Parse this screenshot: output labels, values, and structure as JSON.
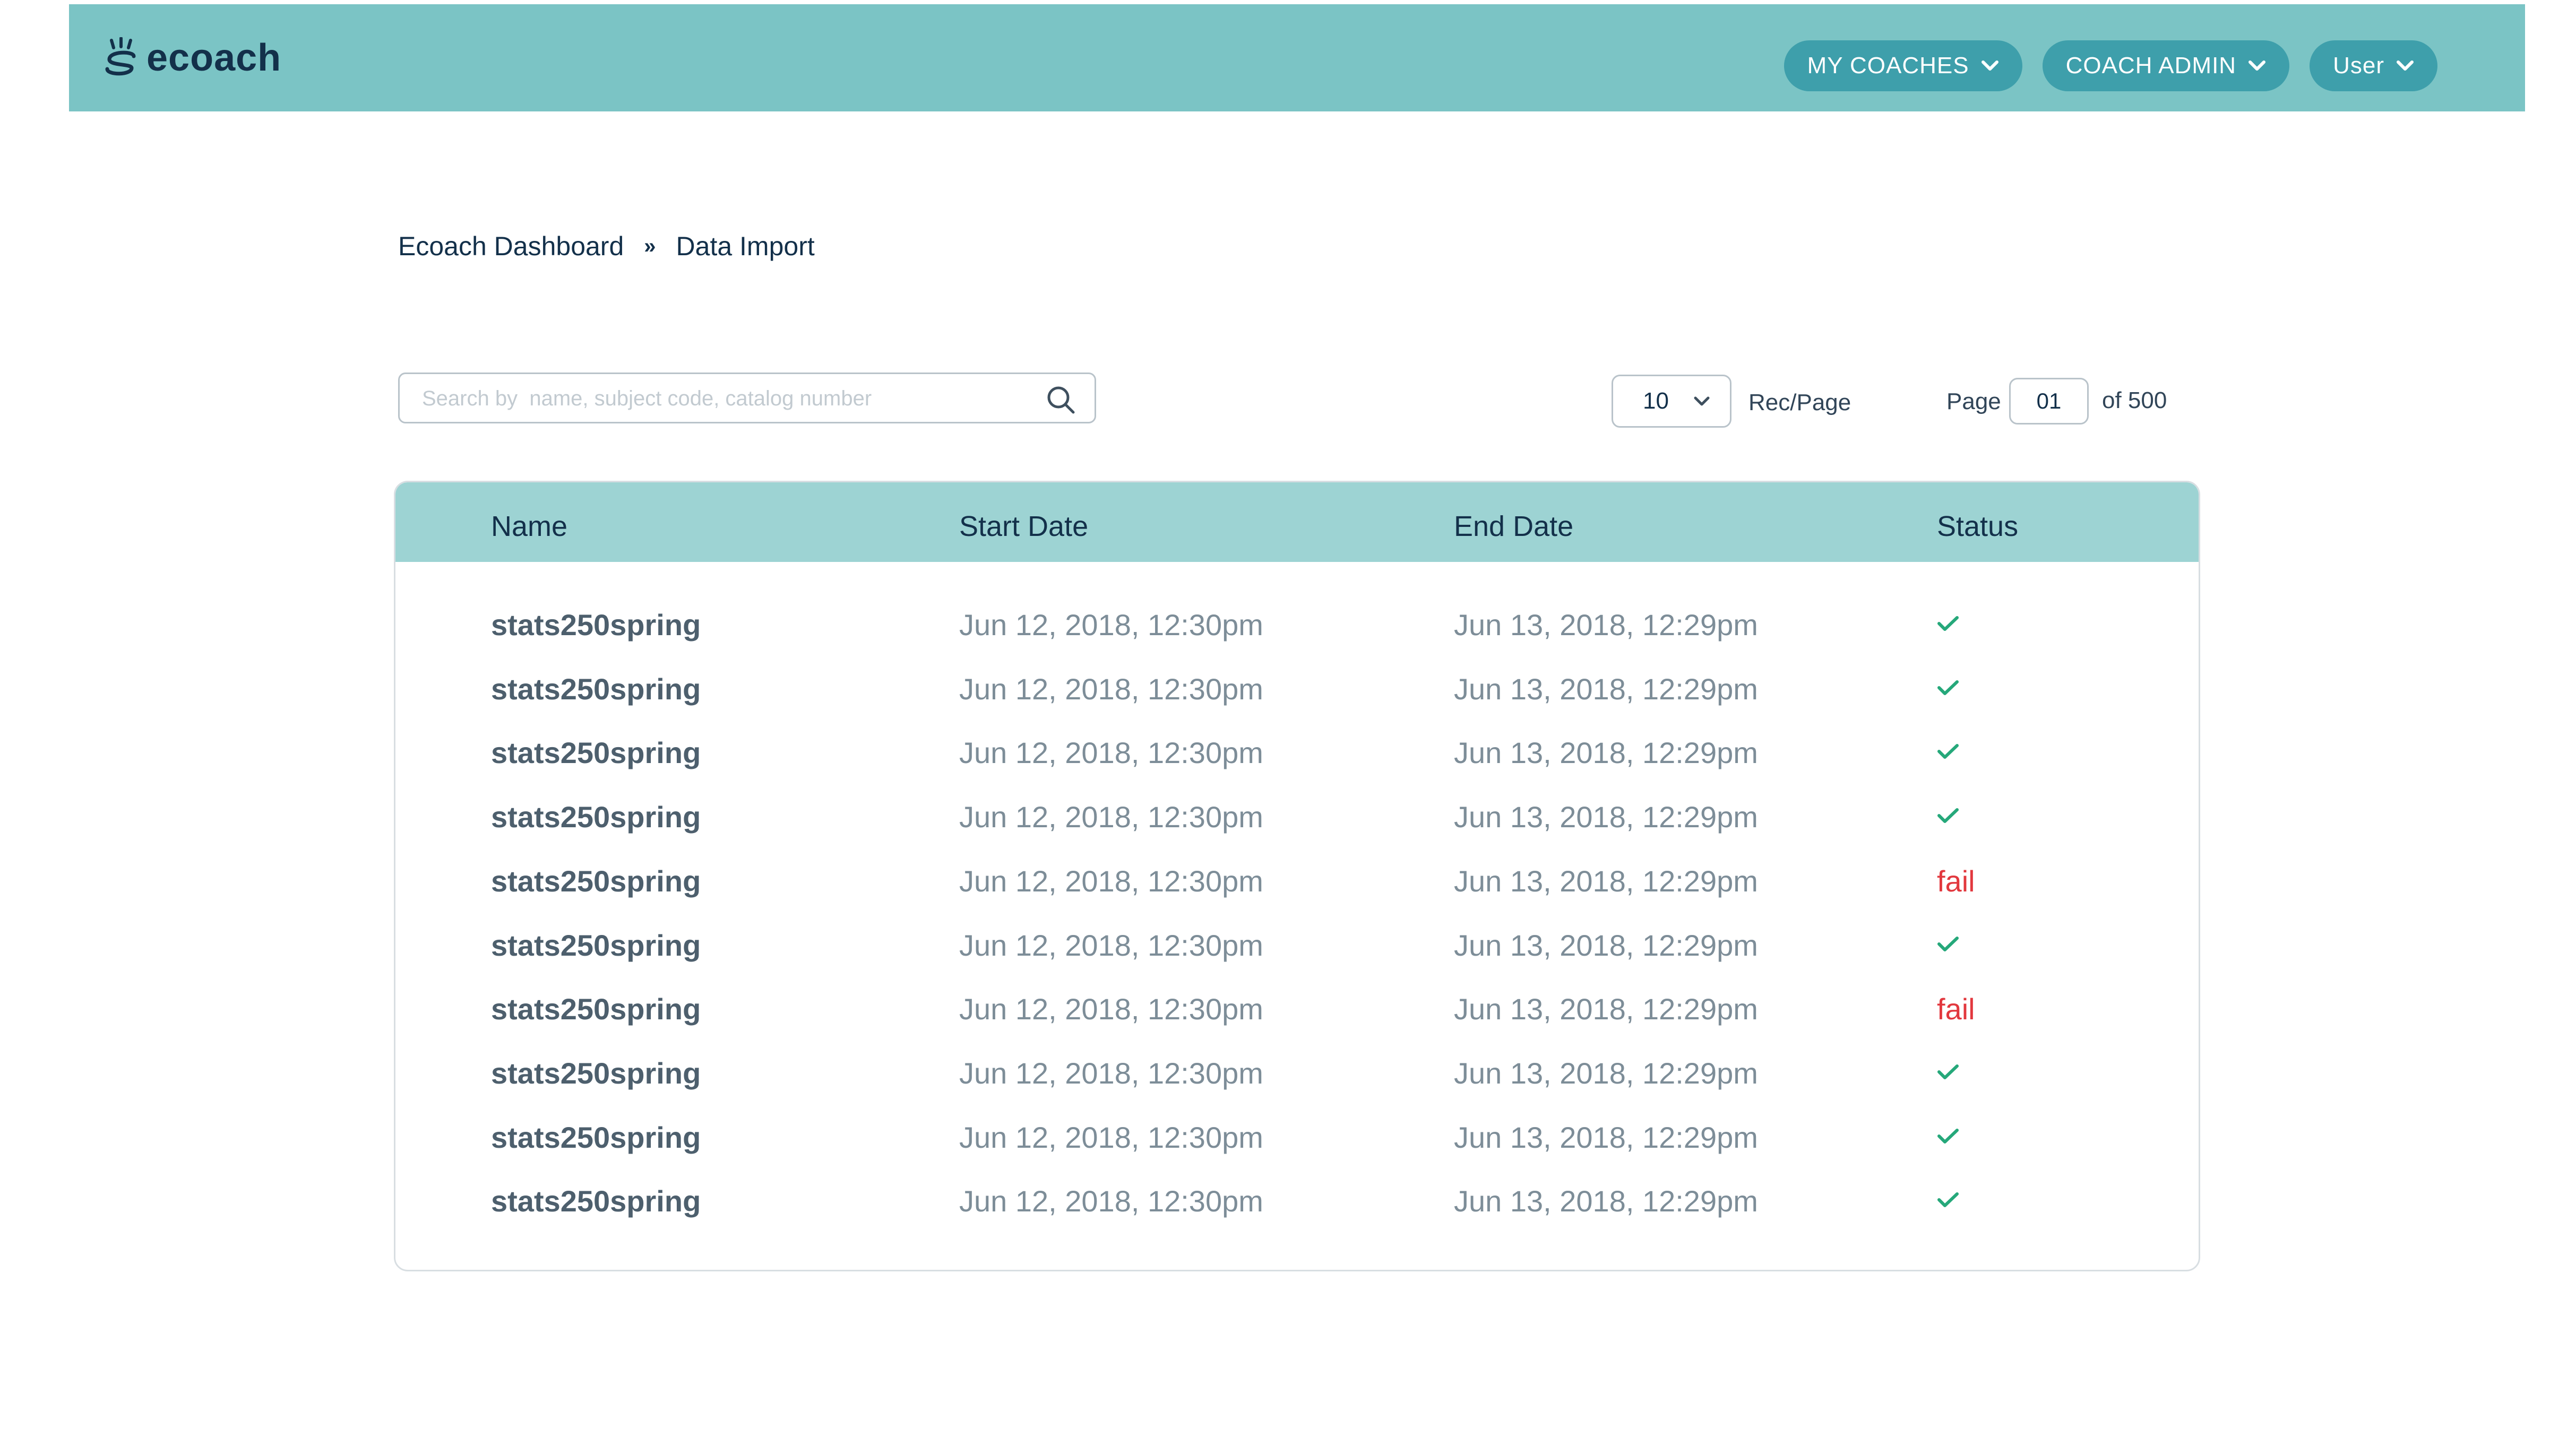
{
  "header": {
    "logo_text": "ecoach",
    "brand_color": "#7bc4c5",
    "nav": [
      {
        "label": "MY COACHES"
      },
      {
        "label": "COACH ADMIN"
      },
      {
        "label": "User"
      }
    ]
  },
  "breadcrumb": {
    "items": [
      "Ecoach Dashboard",
      "Data Import"
    ],
    "separator": "»"
  },
  "toolbar": {
    "search_placeholder": "Search by  name, subject code, catalog number",
    "records_per_page": "10",
    "records_label": "Rec/Page",
    "page_label": "Page",
    "page_value": "01",
    "page_total_label": "of 500"
  },
  "table": {
    "columns": [
      "Name",
      "Start Date",
      "End Date",
      "Status"
    ],
    "rows": [
      {
        "name": "stats250spring",
        "start": "Jun 12, 2018, 12:30pm",
        "end": "Jun 13, 2018, 12:29pm",
        "status": "success"
      },
      {
        "name": "stats250spring",
        "start": "Jun 12, 2018, 12:30pm",
        "end": "Jun 13, 2018, 12:29pm",
        "status": "success"
      },
      {
        "name": "stats250spring",
        "start": "Jun 12, 2018, 12:30pm",
        "end": "Jun 13, 2018, 12:29pm",
        "status": "success"
      },
      {
        "name": "stats250spring",
        "start": "Jun 12, 2018, 12:30pm",
        "end": "Jun 13, 2018, 12:29pm",
        "status": "success"
      },
      {
        "name": "stats250spring",
        "start": "Jun 12, 2018, 12:30pm",
        "end": "Jun 13, 2018, 12:29pm",
        "status": "fail",
        "status_text": "fail"
      },
      {
        "name": "stats250spring",
        "start": "Jun 12, 2018, 12:30pm",
        "end": "Jun 13, 2018, 12:29pm",
        "status": "success"
      },
      {
        "name": "stats250spring",
        "start": "Jun 12, 2018, 12:30pm",
        "end": "Jun 13, 2018, 12:29pm",
        "status": "fail",
        "status_text": "fail"
      },
      {
        "name": "stats250spring",
        "start": "Jun 12, 2018, 12:30pm",
        "end": "Jun 13, 2018, 12:29pm",
        "status": "success"
      },
      {
        "name": "stats250spring",
        "start": "Jun 12, 2018, 12:30pm",
        "end": "Jun 13, 2018, 12:29pm",
        "status": "success"
      },
      {
        "name": "stats250spring",
        "start": "Jun 12, 2018, 12:30pm",
        "end": "Jun 13, 2018, 12:29pm",
        "status": "success"
      }
    ],
    "success_color": "#25a87a",
    "fail_color": "#e2383e"
  }
}
